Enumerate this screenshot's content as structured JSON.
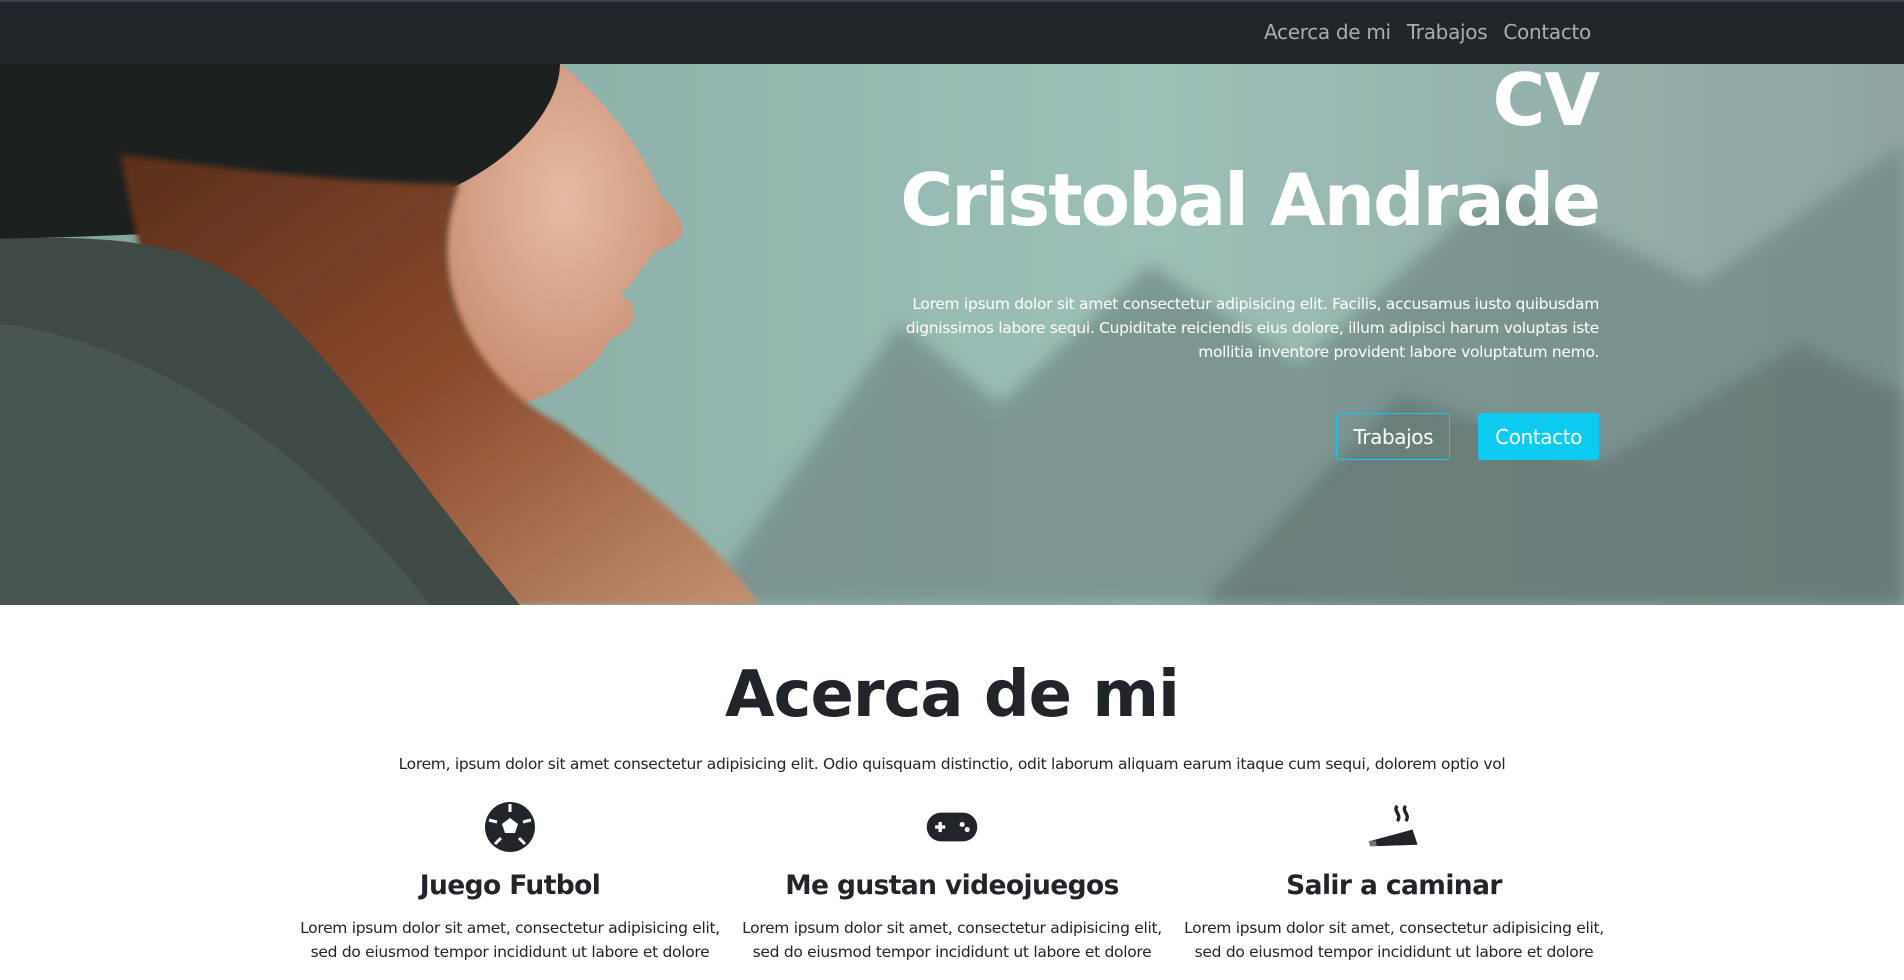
{
  "nav": {
    "links": [
      "Acerca de mi",
      "Trabajos",
      "Contacto"
    ]
  },
  "hero": {
    "cv": "CV",
    "name": "Cristobal Andrade",
    "text": "Lorem ipsum dolor sit amet consectetur adipisicing elit. Facilis, accusamus iusto quibusdam dignissimos labore sequi. Cupiditate reiciendis eius dolore, illum adipisci harum voluptas iste mollitia inventore provident labore voluptatum nemo.",
    "btn_outline": "Trabajos",
    "btn_solid": "Contacto"
  },
  "about": {
    "title": "Acerca de mi",
    "intro": "Lorem, ipsum dolor sit amet consectetur adipisicing elit. Odio quisquam distinctio, odit laborum aliquam earum itaque cum sequi, dolorem optio vol",
    "items": [
      {
        "icon": "soccer-ball-icon",
        "title": "Juego Futbol",
        "text": "Lorem ipsum dolor sit amet, consectetur adipisicing elit, sed do eiusmod tempor incididunt ut labore et dolore"
      },
      {
        "icon": "gamepad-icon",
        "title": "Me gustan videojuegos",
        "text": "Lorem ipsum dolor sit amet, consectetur adipisicing elit, sed do eiusmod tempor incididunt ut labore et dolore"
      },
      {
        "icon": "smoking-icon",
        "title": "Salir a caminar",
        "text": "Lorem ipsum dolor sit amet, consectetur adipisicing elit, sed do eiusmod tempor incididunt ut labore et dolore"
      }
    ]
  },
  "colors": {
    "navbar": "#212529",
    "accent": "#0dcaf0",
    "text": "#212529"
  }
}
